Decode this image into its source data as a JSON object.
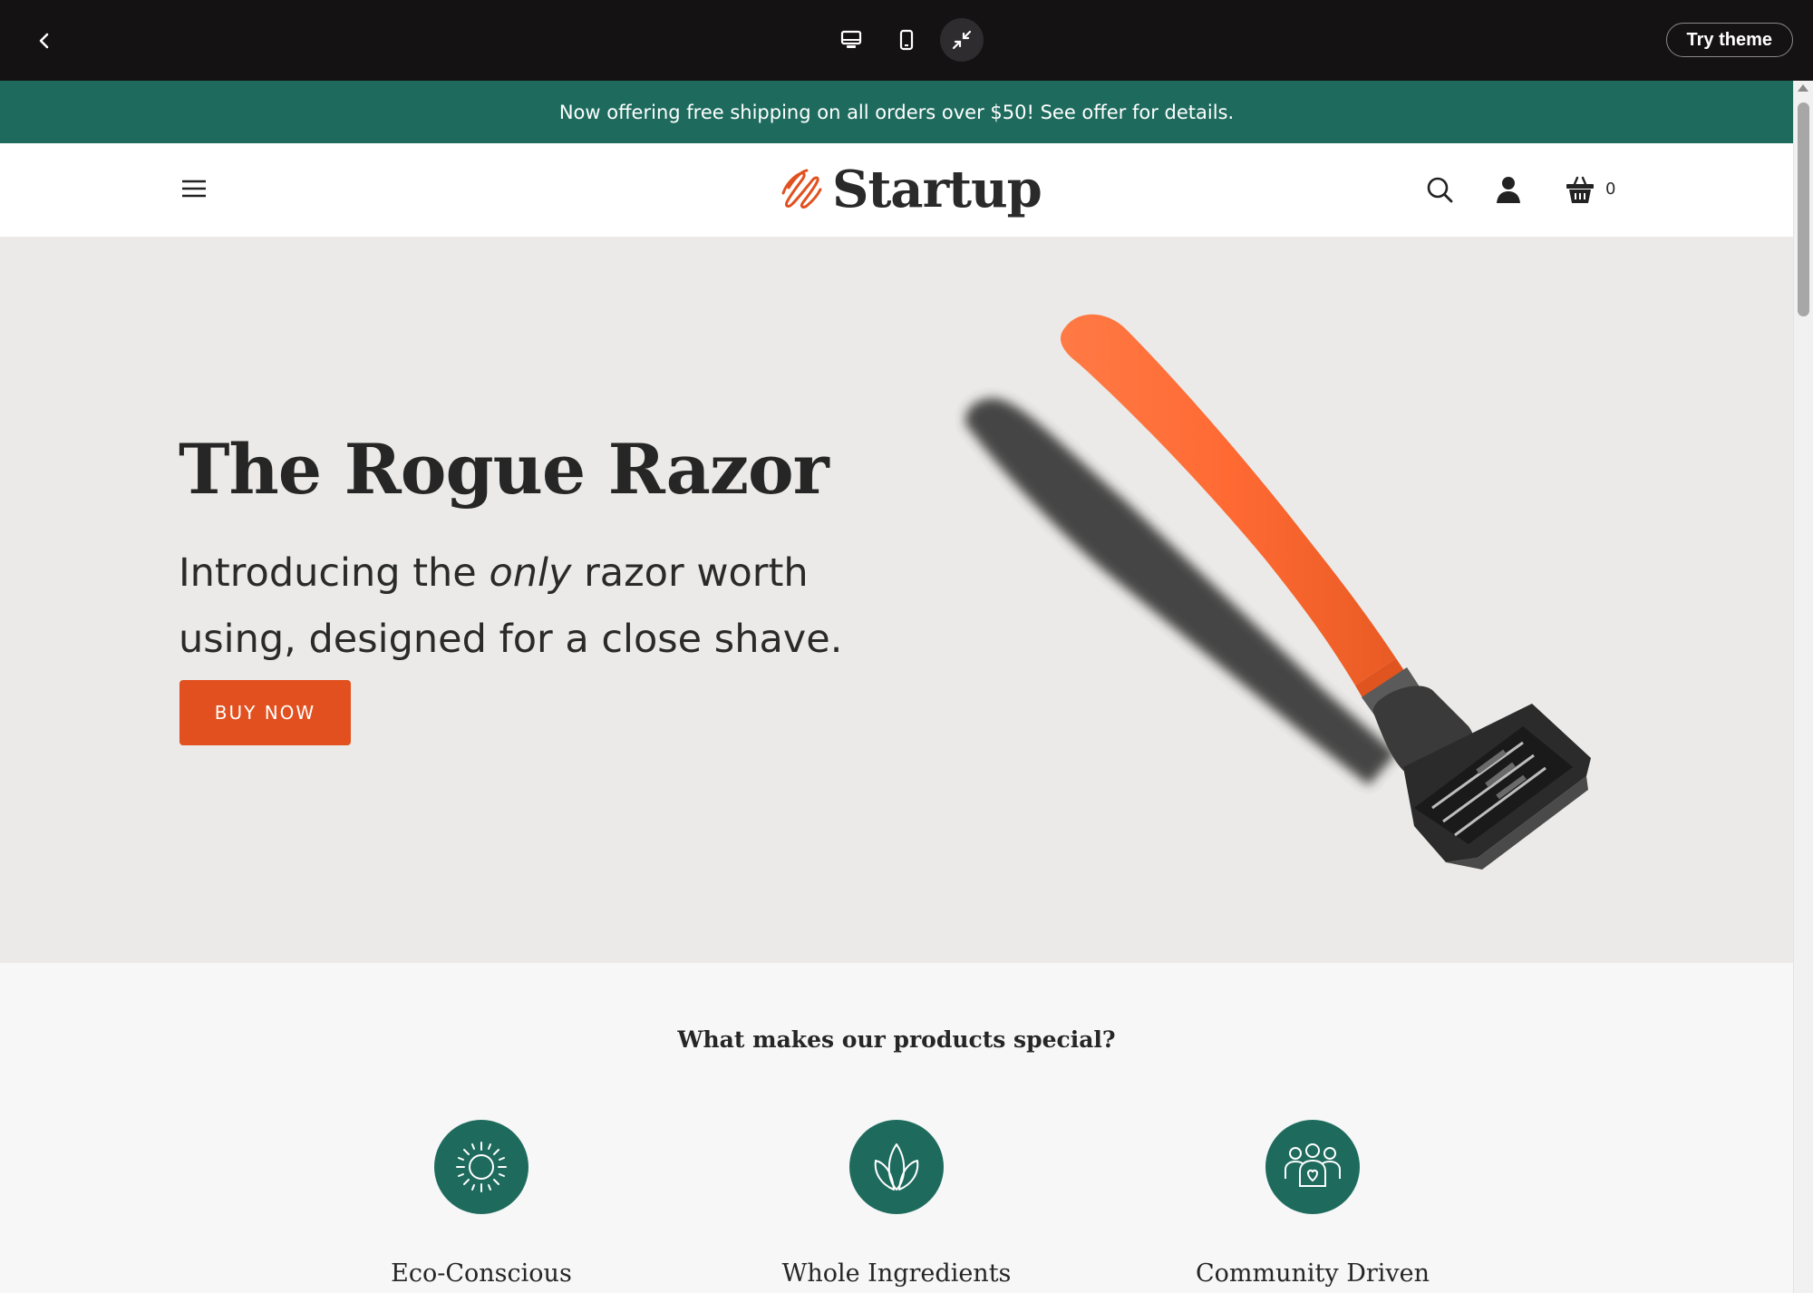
{
  "topbar": {
    "back_icon": "chevron-left-icon",
    "views": [
      {
        "icon": "desktop-icon",
        "active": false
      },
      {
        "icon": "mobile-icon",
        "active": false
      },
      {
        "icon": "collapse-icon",
        "active": true
      }
    ],
    "try_label": "Try theme"
  },
  "announcement": "Now offering free shipping on all orders over $50! See offer for details.",
  "header": {
    "logo_text": "Startup",
    "cart_count": "0",
    "icons": [
      "menu-icon",
      "search-icon",
      "account-icon",
      "cart-icon"
    ]
  },
  "hero": {
    "title": "The Rogue Razor",
    "subtitle_pre": "Introducing the ",
    "subtitle_em": "only",
    "subtitle_post": " razor worth using, designed for a close shave.",
    "button": "BUY NOW"
  },
  "features": {
    "title": "What makes our products special?",
    "items": [
      {
        "label": "Eco-Conscious",
        "icon": "sun-icon"
      },
      {
        "label": "Whole Ingredients",
        "icon": "leaf-icon"
      },
      {
        "label": "Community Driven",
        "icon": "people-icon"
      }
    ]
  },
  "colors": {
    "topbar": "#141213",
    "brand_green": "#1e6b5e",
    "accent_orange": "#e2501f",
    "hero_bg": "#ebeae8"
  }
}
